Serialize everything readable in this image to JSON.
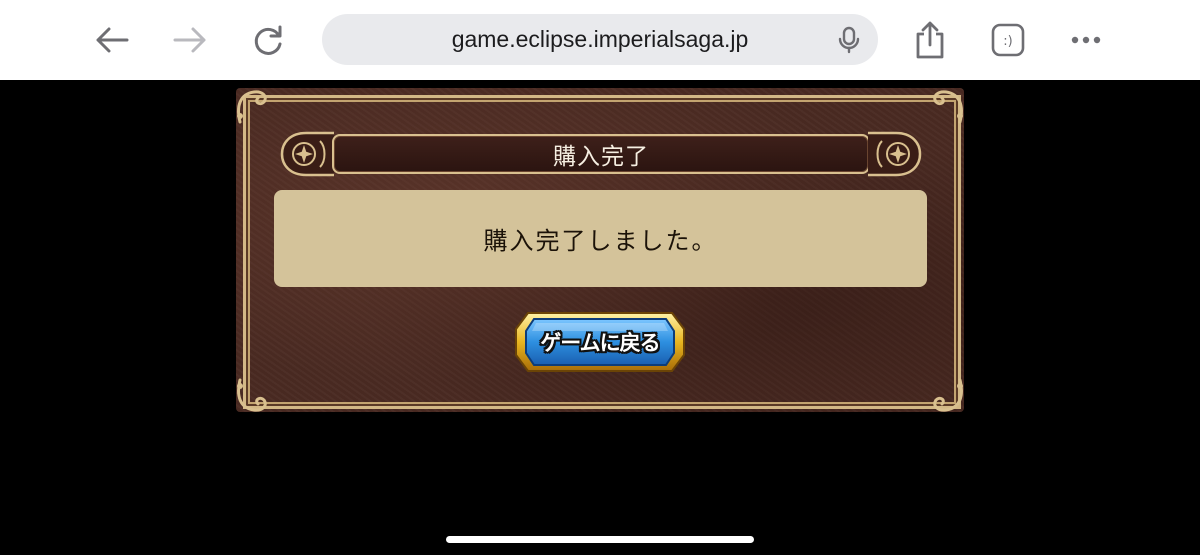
{
  "browser": {
    "url": "game.eclipse.imperialsaga.jp",
    "tabs_label": ":)",
    "icons": {
      "back": "back-arrow-icon",
      "forward": "forward-arrow-icon",
      "reload": "reload-icon",
      "mic": "microphone-icon",
      "share": "share-icon",
      "tabs": "tabs-icon",
      "more": "more-icon"
    },
    "forward_enabled": false
  },
  "dialog": {
    "title": "購入完了",
    "message": "購入完了しました。",
    "return_button_label": "ゲームに戻る"
  },
  "colors": {
    "panel_background": "#4a2a22",
    "panel_border": "#d3b886",
    "message_background": "#d4c39a",
    "button_blue": "#2d8fe0",
    "button_gold": "#f2c230"
  }
}
